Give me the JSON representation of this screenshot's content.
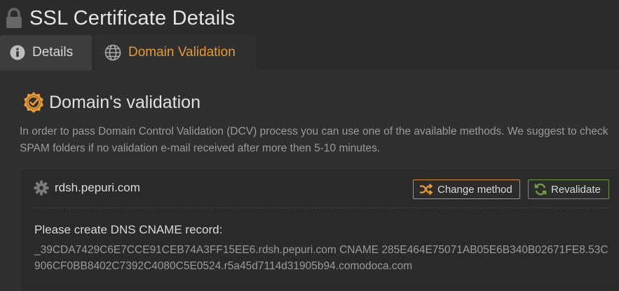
{
  "header": {
    "title": "SSL Certificate Details",
    "icon": "lock-icon"
  },
  "tabs": [
    {
      "label": "Details",
      "icon": "info-icon",
      "active": false
    },
    {
      "label": "Domain Validation",
      "icon": "globe-icon",
      "active": true
    }
  ],
  "section": {
    "title": "Domain's validation",
    "icon": "badge-check-icon",
    "description": "In order to pass Domain Control Validation (DCV) process you can use one of the available methods. We suggest to check SPAM folders if no validation e-mail received after more then 5-10 minutes."
  },
  "domain": {
    "name": "rdsh.pepuri.com",
    "icon": "gear-icon",
    "change_method_label": "Change method",
    "revalidate_label": "Revalidate",
    "instruction": "Please create DNS CNAME record:",
    "record": "_39CDA7429C6E7CCE91CEB74A3FF15EE6.rdsh.pepuri.com CNAME 285E464E75071AB05E6B340B02671FE8.53C906CF0BB8402C7392C4080C5E0524.r5a45d7114d31905b94.comodoca.com"
  },
  "colors": {
    "accent": "#e89a2f",
    "success": "#6e9a3a",
    "background": "#2b2b2b"
  }
}
